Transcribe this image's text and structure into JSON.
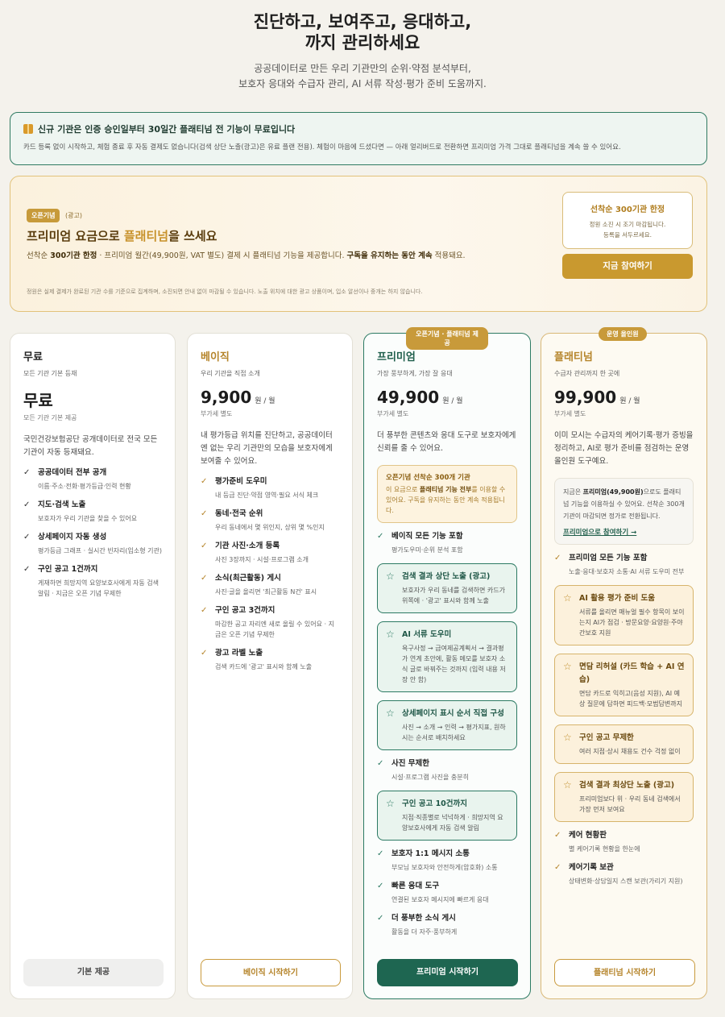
{
  "hero": {
    "title_line1": "진단하고, 보여주고, 응대하고,",
    "title_line2": "까지 관리하세요",
    "subtitle_line1": "공공데이터로 만든 우리 기관만의 순위·약점 분석부터,",
    "subtitle_line2": "보호자 응대와 수급자 관리, AI 서류 작성·평가 준비 도움까지."
  },
  "trial": {
    "title": "신규 기관은 인증 승인일부터 30일간 플래티넘 전 기능이 무료입니다",
    "desc": "카드 등록 없이 시작하고, 체험 종료 후 자동 결제도 없습니다(검색 상단 노출(광고)은 유료 플랜 전용). 체험이 마음에 드셨다면 — 아래 얼리버드로 전환하면 프리미엄 가격 그대로 플래티넘을 계속 쓸 수 있어요."
  },
  "promo": {
    "tag": "오픈기념",
    "ad_label": "(광고)",
    "headline_pre": "프리미엄 요금으로 ",
    "headline_gold": "플래티넘",
    "headline_post": "을 쓰세요",
    "desc_pre": "선착순 ",
    "desc_b1": "300기관 한정",
    "desc_mid": " · 프리미엄 월간(49,900원, VAT 별도) 결제 시 플래티넘 기능을 제공합니다. ",
    "desc_b2": "구독을 유지하는 동안 계속",
    "desc_post": " 적용돼요.",
    "fine": "정원은 실제 결제가 완료된 기관 수를 기준으로 집계하며, 소진되면 안내 없이 마감될 수 있습니다. 노출 위치에 대한 광고 상품이며, 입소 알선이나 중개는 하지 않습니다.",
    "limit_title": "선착순 300기관 한정",
    "limit_sub1": "정원 소진 시 조기 마감됩니다.",
    "limit_sub2": "등록을 서두르세요.",
    "join_label": "지금 참여하기"
  },
  "plans": {
    "free": {
      "name": "무료",
      "sub": "모든 기관 기본 등재",
      "price": "무료",
      "price_note": "모든 기관 기본 제공",
      "intro": "국민건강보험공단 공개데이터로 전국 모든 기관이 자동 등재돼요.",
      "features": [
        {
          "title": "공공데이터 전부 공개",
          "desc": "이름·주소·전화·평가등급·인력 현황"
        },
        {
          "title": "지도·검색 노출",
          "desc": "보호자가 우리 기관을 찾을 수 있어요"
        },
        {
          "title": "상세페이지 자동 생성",
          "desc": "평가등급 그래프 · 실시간 빈자리(입소형 기관)"
        },
        {
          "title": "구인 공고 1건까지",
          "desc": "게재하면 희망지역 요양보호사에게 자동 검색 알림 · 지금은 오픈 기념 무제한"
        }
      ],
      "cta": "기본 제공"
    },
    "basic": {
      "name": "베이직",
      "sub": "우리 기관을 직접 소개",
      "price": "9,900",
      "unit": "원 / 월",
      "vat": "부가세 별도",
      "intro": "내 평가등급 위치를 진단하고, 공공데이터엔 없는 우리 기관만의 모습을 보호자에게 보여줄 수 있어요.",
      "features": [
        {
          "title": "평가준비 도우미",
          "desc": "내 등급 진단·약점 영역·필요 서식 체크"
        },
        {
          "title": "동네·전국 순위",
          "desc": "우리 동네에서 몇 위인지, 상위 몇 %인지"
        },
        {
          "title": "기관 사진·소개 등록",
          "desc": "사진 3장까지 · 시설·프로그램 소개"
        },
        {
          "title": "소식(최근활동) 게시",
          "desc": "사진·글을 올리면 '최근활동 N건' 표시"
        },
        {
          "title": "구인 공고 3건까지",
          "desc": "마감한 공고 자리엔 새로 올릴 수 있어요 · 지금은 오픈 기념 무제한"
        },
        {
          "title": "광고 라벨 노출",
          "desc": "검색 카드에 '광고' 표시와 함께 노출"
        }
      ],
      "cta": "베이직 시작하기"
    },
    "premium": {
      "badge": "오픈기념 · 플래티넘 제공",
      "name": "프리미엄",
      "sub": "가장 풍부하게, 가장 잘 응대",
      "price": "49,900",
      "unit": "원 / 월",
      "vat": "부가세 별도",
      "intro": "더 풍부한 콘텐츠와 응대 도구로 보호자에게 신뢰를 줄 수 있어요.",
      "notice_title": "오픈기념 선착순 300개 기관",
      "notice_pre": "이 요금으로 ",
      "notice_b": "플래티넘 기능 전부",
      "notice_post": "를 이용할 수 있어요. 구독을 유지하는 동안 계속 적용됩니다.",
      "base_feature": {
        "title": "베이직 모든 기능 포함",
        "desc": "평가도우미·순위 분석 포함"
      },
      "highlights": [
        {
          "title": "검색 결과 상단 노출 (광고)",
          "desc": "보호자가 우리 동네를 검색하면 카드가 위쪽에 · '광고' 표시와 함께 노출"
        },
        {
          "title": "AI 서류 도우미",
          "desc": "욕구사정 → 급여제공계획서 → 결과평가 연계 초안에, 활동 메모를 보호자 소식 글로 바꿔주는 것까지 (입력 내용 저장 안 함)"
        },
        {
          "title": "상세페이지 표시 순서 직접 구성",
          "desc": "사진 → 소개 → 인력 → 평가지표, 원하시는 순서로 배치하세요"
        }
      ],
      "mid_feature": {
        "title": "사진 무제한",
        "desc": "시설·프로그램 사진을 충분히"
      },
      "highlight_recruit": {
        "title": "구인 공고 10건까지",
        "desc": "지점·직종별로 넉넉하게 · 희망지역 요양보호사에게 자동 검색 알림"
      },
      "tail_features": [
        {
          "title": "보호자 1:1 메시지 소통",
          "desc": "부모님 보호자와 안전하게(암호화) 소통"
        },
        {
          "title": "빠른 응대 도구",
          "desc": "연결된 보호자 메시지에 빠르게 응대"
        },
        {
          "title": "더 풍부한 소식 게시",
          "desc": "활동을 더 자주·풍부하게"
        }
      ],
      "cta": "프리미엄 시작하기"
    },
    "platinum": {
      "badge": "운영 올인원",
      "name": "플래티넘",
      "sub": "수급자 관리까지 한 곳에",
      "price": "99,900",
      "unit": "원 / 월",
      "vat": "부가세 별도",
      "intro": "이미 모시는 수급자의 케어기록·평가 증빙을 정리하고, AI로 평가 준비를 점검하는 운영 올인원 도구예요.",
      "info_pre": "지금은 ",
      "info_b": "프리미엄(49,900원)",
      "info_post": "으로도 플래티넘 기능을 이용하실 수 있어요. 선착순 300개 기관이 마감되면 정가로 전환됩니다.",
      "info_link": "프리미엄으로 참여하기 →",
      "base_feature": {
        "title": "프리미엄 모든 기능 포함",
        "desc": "노출·응대·보호자 소통·AI 서류 도우미 전부"
      },
      "highlights": [
        {
          "title": "AI 활용 평가 준비 도움",
          "desc": "서류를 올리면 매뉴얼 필수 항목이 보이는지 AI가 점검 · 방문요양·요양원·주야간보호 지원"
        },
        {
          "title": "면담 리허설 (카드 학습 + AI 연습)",
          "desc": "면담 카드로 익히고(음성 지원), AI 예상 질문에 답하면 피드백·모범답변까지"
        },
        {
          "title": "구인 공고 무제한",
          "desc": "여러 지점·상시 채용도 건수 걱정 없이"
        },
        {
          "title": "검색 결과 최상단 노출 (광고)",
          "desc": "프리미엄보다 위 · 우리 동네 검색에서 가장 먼저 보여요"
        }
      ],
      "tail_features": [
        {
          "title": "케어 현황판",
          "desc": "별 케어기록 현황을 한눈에"
        },
        {
          "title": "케어기록 보관",
          "desc": "상태변화·상담일지 스캔 보관(가리기 지원)"
        }
      ],
      "cta": "플래티넘 시작하기"
    }
  },
  "colors": {
    "accent_green": "#1e6651",
    "accent_gold": "#c9992f"
  }
}
